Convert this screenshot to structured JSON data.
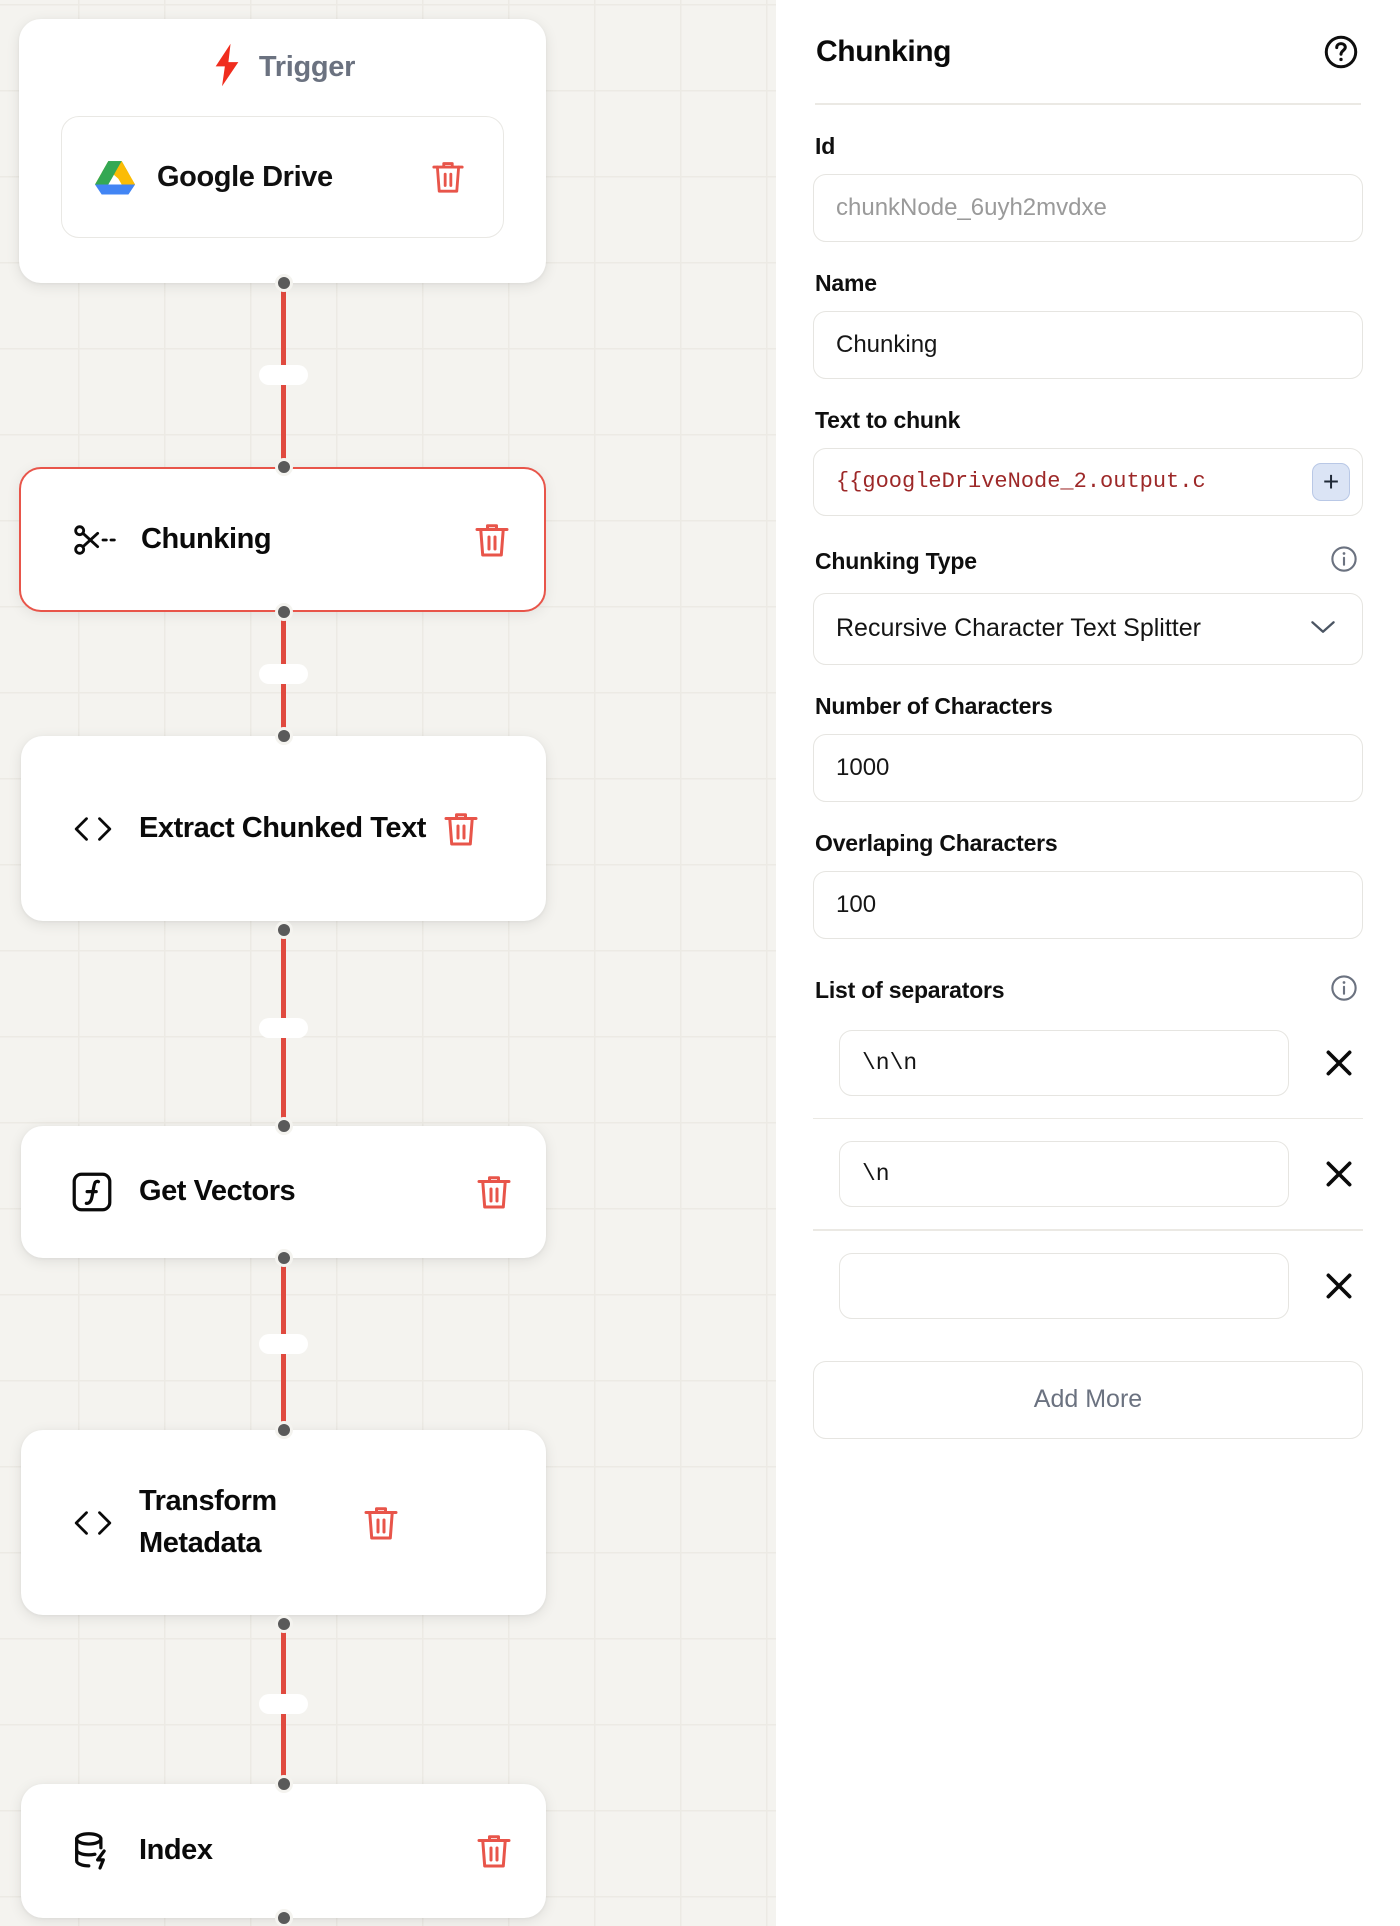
{
  "canvas": {
    "trigger": {
      "label": "Trigger",
      "icon": "lightning-bolt-icon",
      "source": {
        "label": "Google Drive",
        "icon": "google-drive-icon",
        "delete_icon": "trash-icon"
      }
    },
    "nodes": [
      {
        "label": "Chunking",
        "icon": "scissors-icon",
        "delete_icon": "trash-icon",
        "selected": true
      },
      {
        "label": "Extract Chunked Text",
        "icon": "code-brackets-icon",
        "delete_icon": "trash-icon",
        "selected": false
      },
      {
        "label": "Get Vectors",
        "icon": "function-icon",
        "delete_icon": "trash-icon",
        "selected": false
      },
      {
        "label": "Transform Metadata",
        "icon": "code-brackets-icon",
        "delete_icon": "trash-icon",
        "selected": false
      },
      {
        "label": "Index",
        "icon": "database-lightning-icon",
        "delete_icon": "trash-icon",
        "selected": false
      }
    ]
  },
  "panel": {
    "title": "Chunking",
    "help_icon": "question-circle-icon",
    "id_field": {
      "label": "Id",
      "placeholder": "chunkNode_6uyh2mvdxe",
      "value": ""
    },
    "name_field": {
      "label": "Name",
      "value": "Chunking"
    },
    "text_to_chunk": {
      "label": "Text to chunk",
      "value": "{{googleDriveNode_2.output.c",
      "add_button": "+",
      "add_icon": "plus-icon"
    },
    "chunking_type": {
      "label": "Chunking Type",
      "info_icon": "info-circle-icon",
      "value": "Recursive Character Text Splitter",
      "chevron_icon": "chevron-down-icon"
    },
    "number_of_characters": {
      "label": "Number of Characters",
      "value": "1000"
    },
    "overlapping_characters": {
      "label": "Overlaping Characters",
      "value": "100"
    },
    "separators": {
      "label": "List of separators",
      "info_icon": "info-circle-icon",
      "remove_icon": "close-x-icon",
      "items": [
        "\\n\\n",
        "\\n",
        ""
      ],
      "add_more_label": "Add More"
    }
  },
  "colors": {
    "accent_red": "#e04a3f",
    "trash_red": "#e8554a",
    "canvas_bg": "#f4f3ef",
    "code_text": "#9d2828"
  }
}
